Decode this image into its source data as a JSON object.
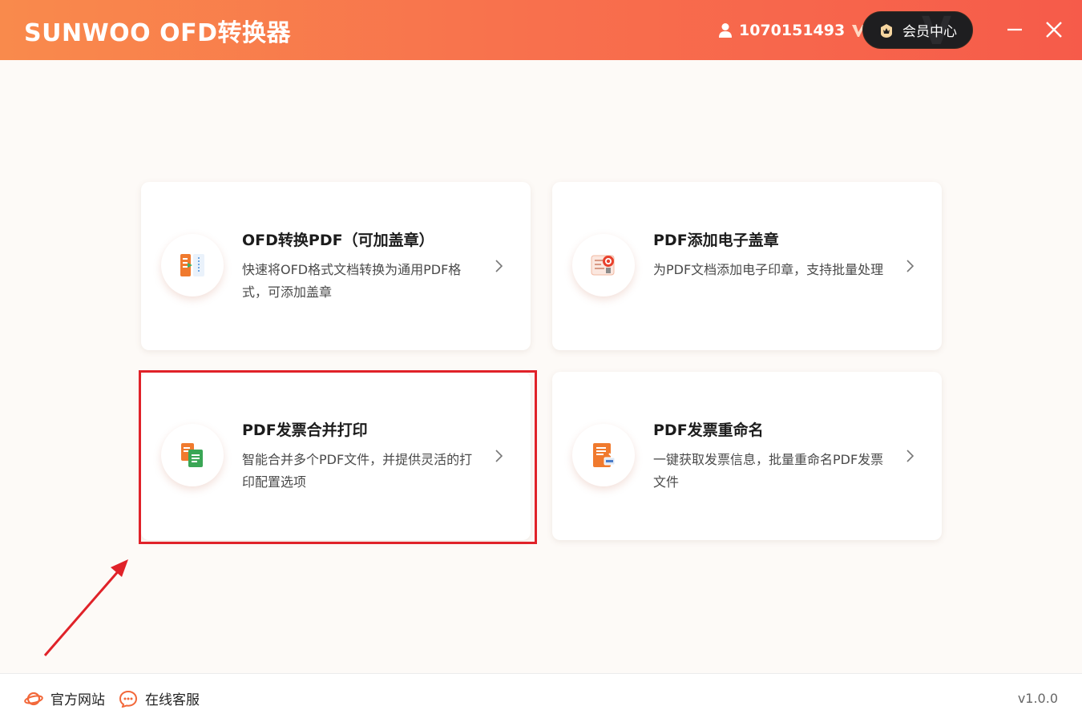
{
  "header": {
    "app_title": "SUNWOO OFD转换器",
    "user_id": "1070151493",
    "member_button": "会员中心"
  },
  "cards": [
    {
      "title": "OFD转换PDF（可加盖章）",
      "desc": "快速将OFD格式文档转换为通用PDF格式，可添加盖章",
      "icon": "ofd-convert-icon"
    },
    {
      "title": "PDF添加电子盖章",
      "desc": "为PDF文档添加电子印章，支持批量处理",
      "icon": "stamp-icon"
    },
    {
      "title": "PDF发票合并打印",
      "desc": "智能合并多个PDF文件，并提供灵活的打印配置选项",
      "icon": "merge-print-icon"
    },
    {
      "title": "PDF发票重命名",
      "desc": "一键获取发票信息，批量重命名PDF发票文件",
      "icon": "rename-icon"
    }
  ],
  "footer": {
    "site_label": "官方网站",
    "service_label": "在线客服",
    "version": "v1.0.0"
  },
  "colors": {
    "header_start": "#f98a4c",
    "header_end": "#f65b4a",
    "highlight": "#e02229",
    "accent": "#f2683a"
  }
}
